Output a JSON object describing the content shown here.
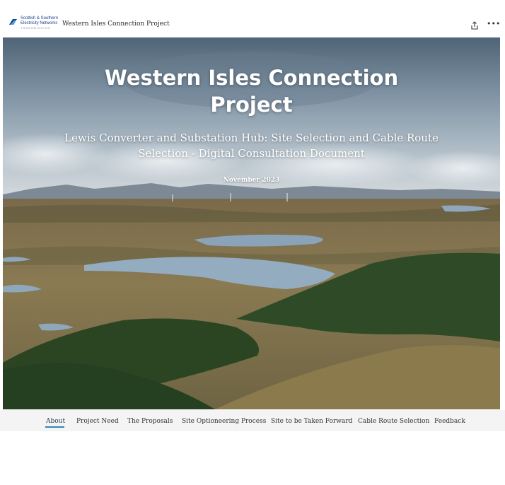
{
  "header": {
    "logo": {
      "line1": "Scottish & Southern",
      "line2": "Electricity Networks",
      "line3": "TRANSMISSION"
    },
    "app_title": "Western Isles Connection Project",
    "share_icon": "share-icon",
    "more_icon": "more-options-icon"
  },
  "hero": {
    "title_line1": "Western Isles Connection",
    "title_line2": "Project",
    "subtitle_line1": "Lewis Converter and Substation Hub: Site Selection and Cable Route",
    "subtitle_line2": "Selection - Digital Consultation Document",
    "date": "November 2023"
  },
  "nav": {
    "items": [
      {
        "label": "About",
        "active": true
      },
      {
        "label": "Project Need",
        "active": false
      },
      {
        "label": "The Proposals",
        "active": false
      },
      {
        "label": "Site Optioneering Process",
        "active": false
      },
      {
        "label": "Site to be Taken Forward",
        "active": false
      },
      {
        "label": "Cable Route Selection",
        "active": false
      },
      {
        "label": "Feedback",
        "active": false
      }
    ],
    "active_color": "#2e86b8"
  }
}
